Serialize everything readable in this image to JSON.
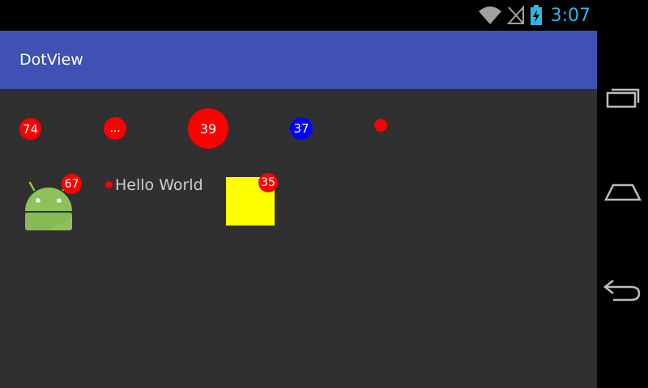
{
  "status_bar": {
    "time": "3:07",
    "icons": [
      "wifi-icon",
      "signal-icon",
      "battery-charging-icon"
    ],
    "time_color": "#33b5e5"
  },
  "app_bar": {
    "title": "DotView",
    "color": "#3f51b5"
  },
  "dots_row": [
    {
      "label": "74",
      "color": "#ff0000"
    },
    {
      "label": "...",
      "color": "#ff0000"
    },
    {
      "label": "39",
      "color": "#ff0000"
    },
    {
      "label": "37",
      "color": "#0000ff"
    },
    {
      "label": "",
      "color": "#ff0000"
    }
  ],
  "badges": {
    "android_badge": "67",
    "hello_text": "Hello World",
    "square_badge": "35",
    "square_color": "#ffff00"
  },
  "nav_bar": {
    "icons": [
      "recent-apps-icon",
      "home-icon",
      "back-icon"
    ]
  },
  "content_background": "#303030"
}
